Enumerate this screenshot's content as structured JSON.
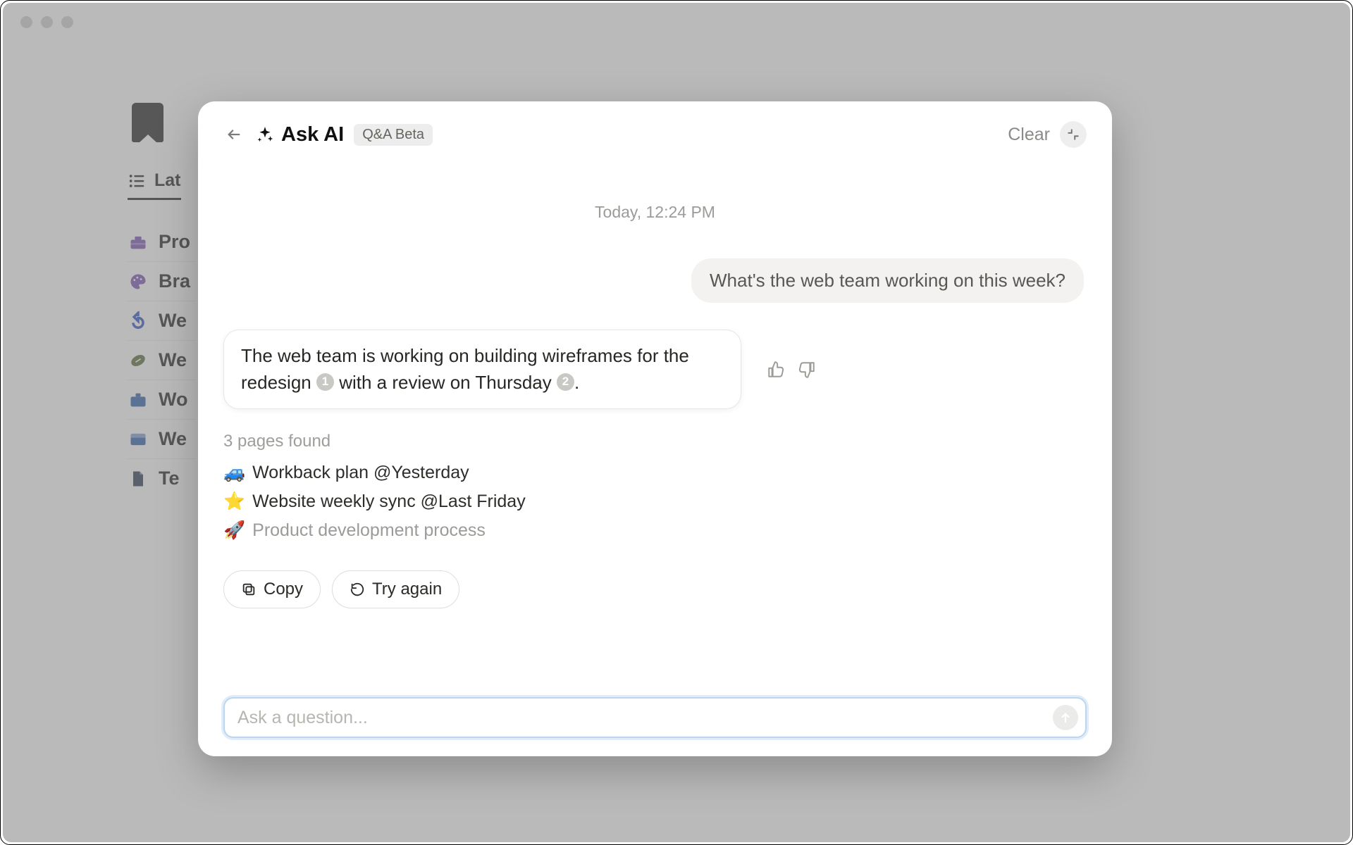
{
  "background": {
    "tab_label": "Lat",
    "items": [
      {
        "icon": "toolbox-icon",
        "emoji": "🧰",
        "label": "Pro",
        "color": "#7a52b3"
      },
      {
        "icon": "palette-icon",
        "emoji": "🎨",
        "label": "Bra",
        "color": "#7a52b3"
      },
      {
        "icon": "undo-icon",
        "emoji": "↩️",
        "label": "We",
        "color": "#2d55c4"
      },
      {
        "icon": "football-icon",
        "emoji": "🏈",
        "label": "We",
        "color": "#5a6b3a"
      },
      {
        "icon": "briefcase-icon",
        "emoji": "💼",
        "label": "Wo",
        "color": "#2e5fae"
      },
      {
        "icon": "window-icon",
        "emoji": "🗔",
        "label": "We",
        "color": "#2e5fae"
      },
      {
        "icon": "document-icon",
        "emoji": "📄",
        "label": "Te",
        "color": "#2a3a55"
      }
    ]
  },
  "modal": {
    "title": "Ask AI",
    "badge": "Q&A Beta",
    "clear_label": "Clear",
    "timestamp": "Today, 12:24 PM",
    "user_message": "What's the web team working on this week?",
    "ai_message_pre": "The web team is working on building wireframes for the redesign ",
    "ai_chip_1": "1",
    "ai_message_mid": " with a review on Thursday ",
    "ai_chip_2": "2",
    "ai_message_post": ".",
    "pages_found_label": "3 pages found",
    "sources": [
      {
        "emoji": "🚙",
        "text": "Workback plan @Yesterday",
        "dim": false
      },
      {
        "emoji": "⭐",
        "text": "Website weekly sync @Last Friday",
        "dim": false
      },
      {
        "emoji": "🚀",
        "text": "Product development process",
        "dim": true
      }
    ],
    "copy_label": "Copy",
    "try_again_label": "Try again",
    "input_placeholder": "Ask a question..."
  }
}
